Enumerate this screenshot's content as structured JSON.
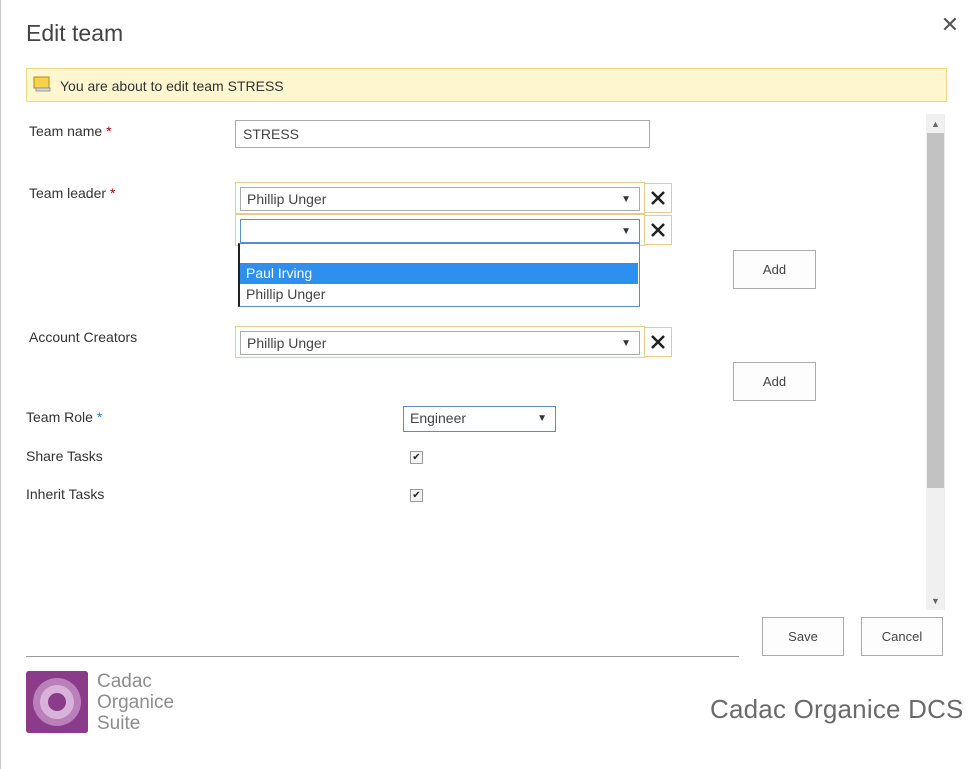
{
  "dialog": {
    "title": "Edit team"
  },
  "banner": {
    "text": "You are about to edit team STRESS"
  },
  "form": {
    "team_name": {
      "label": "Team name",
      "required": "*",
      "value": "STRESS"
    },
    "team_leader": {
      "label": "Team leader",
      "required": "*",
      "selected_1": "Phillip Unger",
      "selected_2": "",
      "options": [
        "Paul Irving",
        "Phillip Unger"
      ],
      "highlighted_option": "Paul Irving",
      "add_label": "Add"
    },
    "account_creators": {
      "label": "Account Creators",
      "selected_1": "Phillip Unger",
      "add_label": "Add"
    },
    "team_role": {
      "label": "Team Role",
      "required": "*",
      "value": "Engineer"
    },
    "share_tasks": {
      "label": "Share Tasks",
      "checked": true
    },
    "inherit_tasks": {
      "label": "Inherit Tasks",
      "checked": true
    }
  },
  "actions": {
    "save_label": "Save",
    "cancel_label": "Cancel"
  },
  "footer": {
    "logo_line1": "Cadac",
    "logo_line2": "Organice",
    "logo_line3": "Suite",
    "brand_right": "Cadac Organice DCS"
  },
  "colors": {
    "banner_bg": "#fdf6cf",
    "selection": "#2d8ff0",
    "required": "#b00000",
    "logo": "#8c3d8c"
  }
}
